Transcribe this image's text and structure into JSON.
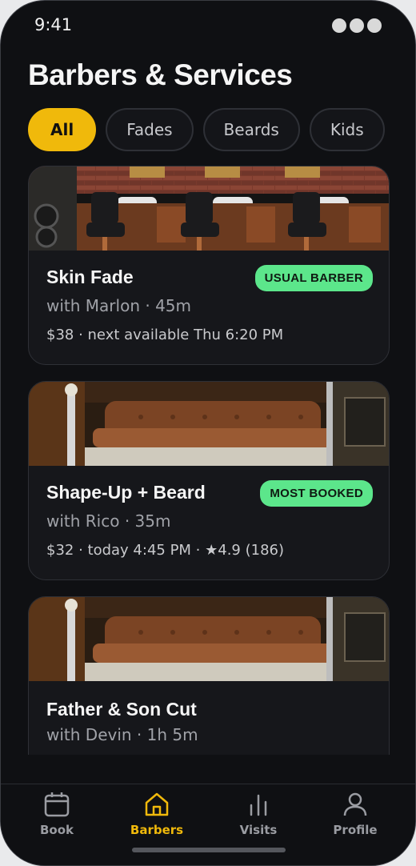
{
  "status_bar": {
    "time": "9:41"
  },
  "header": {
    "title": "Barbers & Services"
  },
  "filters": [
    {
      "label": "All",
      "active": true
    },
    {
      "label": "Fades",
      "active": false
    },
    {
      "label": "Beards",
      "active": false
    },
    {
      "label": "Kids",
      "active": false
    }
  ],
  "services": [
    {
      "title": "Skin Fade",
      "subtitle": "with Marlon · 45m",
      "meta": "$38 · next available Thu 6:20 PM",
      "badge": "USUAL BARBER",
      "image": "barbershop-interior-photo"
    },
    {
      "title": "Shape-Up + Beard",
      "subtitle": "with Rico · 35m",
      "meta": "$32 · today 4:45 PM · ★4.9 (186)",
      "badge": "MOST BOOKED",
      "image": "barber-chair-photo"
    },
    {
      "title": "Father & Son Cut",
      "subtitle": "with Devin · 1h 5m",
      "meta": "",
      "badge": "",
      "image": "barber-chair-photo"
    }
  ],
  "tabbar": {
    "items": [
      {
        "label": "Book",
        "icon": "calendar-icon",
        "active": false
      },
      {
        "label": "Barbers",
        "icon": "home-icon",
        "active": true
      },
      {
        "label": "Visits",
        "icon": "bar-chart-icon",
        "active": false
      },
      {
        "label": "Profile",
        "icon": "user-icon",
        "active": false
      }
    ]
  },
  "colors": {
    "accent": "#f0b90b",
    "badge": "#5ce68b",
    "background": "#0f1013",
    "card": "#16171b"
  }
}
